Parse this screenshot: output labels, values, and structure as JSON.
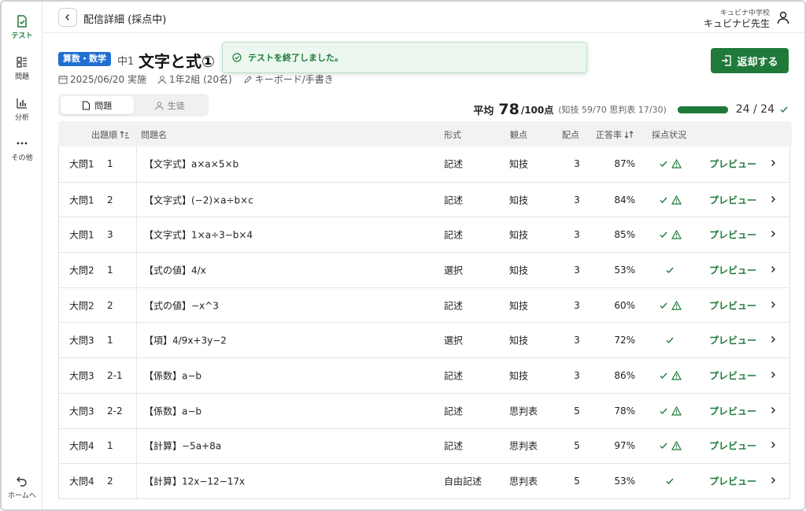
{
  "sidebar": {
    "items": [
      {
        "label": "テスト",
        "icon": "test-doc-icon",
        "active": true
      },
      {
        "label": "問題",
        "icon": "questions-grid-icon",
        "active": false
      },
      {
        "label": "分析",
        "icon": "bar-chart-icon",
        "active": false
      },
      {
        "label": "その他",
        "icon": "more-dots-icon",
        "active": false
      }
    ],
    "home_label": "ホームへ"
  },
  "header": {
    "title": "配信詳細 (採点中)",
    "school": "キュビナ中学校",
    "user": "キュビナビ先生"
  },
  "test": {
    "subject": "算数・数学",
    "grade": "中1",
    "title": "文字と式①",
    "date": "2025/06/20 実施",
    "class": "1年2組 (20名)",
    "input": "キーボード/手書き"
  },
  "toast": {
    "message": "テストを終了しました。"
  },
  "actions": {
    "return_label": "返却する"
  },
  "tabs": [
    {
      "label": "問題",
      "active": true
    },
    {
      "label": "生徒",
      "active": false
    }
  ],
  "summary": {
    "avg_label": "平均",
    "avg_value": "78",
    "avg_unit": "/100点",
    "detail": "(知技 59/70  思判表 17/30)",
    "progress_count": "24 / 24",
    "progress_fraction": 1.0
  },
  "table": {
    "headers": {
      "order": "出題順",
      "name": "問題名",
      "type": "形式",
      "viewpoint": "観点",
      "score": "配点",
      "rate": "正答率",
      "status": "採点状況"
    },
    "rows": [
      {
        "big": "大問1",
        "num": "1",
        "name": "【文字式】a×a×5×b",
        "type": "記述",
        "viewpoint": "知技",
        "score": "3",
        "rate": "87%",
        "warn": true,
        "preview": "プレビュー"
      },
      {
        "big": "大問1",
        "num": "2",
        "name": "【文字式】(−2)×a÷b×c",
        "type": "記述",
        "viewpoint": "知技",
        "score": "3",
        "rate": "84%",
        "warn": true,
        "preview": "プレビュー"
      },
      {
        "big": "大問1",
        "num": "3",
        "name": "【文字式】1×a÷3−b×4",
        "type": "記述",
        "viewpoint": "知技",
        "score": "3",
        "rate": "85%",
        "warn": true,
        "preview": "プレビュー"
      },
      {
        "big": "大問2",
        "num": "1",
        "name": "【式の値】4/x",
        "type": "選択",
        "viewpoint": "知技",
        "score": "3",
        "rate": "53%",
        "warn": false,
        "preview": "プレビュー"
      },
      {
        "big": "大問2",
        "num": "2",
        "name": "【式の値】−x^3",
        "type": "記述",
        "viewpoint": "知技",
        "score": "3",
        "rate": "60%",
        "warn": true,
        "preview": "プレビュー"
      },
      {
        "big": "大問3",
        "num": "1",
        "name": "【項】4/9x+3y−2",
        "type": "選択",
        "viewpoint": "知技",
        "score": "3",
        "rate": "72%",
        "warn": false,
        "preview": "プレビュー"
      },
      {
        "big": "大問3",
        "num": "2-1",
        "name": "【係数】a−b",
        "type": "記述",
        "viewpoint": "知技",
        "score": "3",
        "rate": "86%",
        "warn": true,
        "preview": "プレビュー"
      },
      {
        "big": "大問3",
        "num": "2-2",
        "name": "【係数】a−b",
        "type": "記述",
        "viewpoint": "思判表",
        "score": "5",
        "rate": "78%",
        "warn": true,
        "preview": "プレビュー"
      },
      {
        "big": "大問4",
        "num": "1",
        "name": "【計算】−5a+8a",
        "type": "記述",
        "viewpoint": "思判表",
        "score": "5",
        "rate": "97%",
        "warn": true,
        "preview": "プレビュー"
      },
      {
        "big": "大問4",
        "num": "2",
        "name": "【計算】12x−12−17x",
        "type": "自由記述",
        "viewpoint": "思判表",
        "score": "5",
        "rate": "53%",
        "warn": false,
        "preview": "プレビュー"
      }
    ]
  },
  "colors": {
    "accent": "#1f7a3a",
    "badge": "#1f6fd1",
    "toast_bg": "#ecf8ef"
  }
}
